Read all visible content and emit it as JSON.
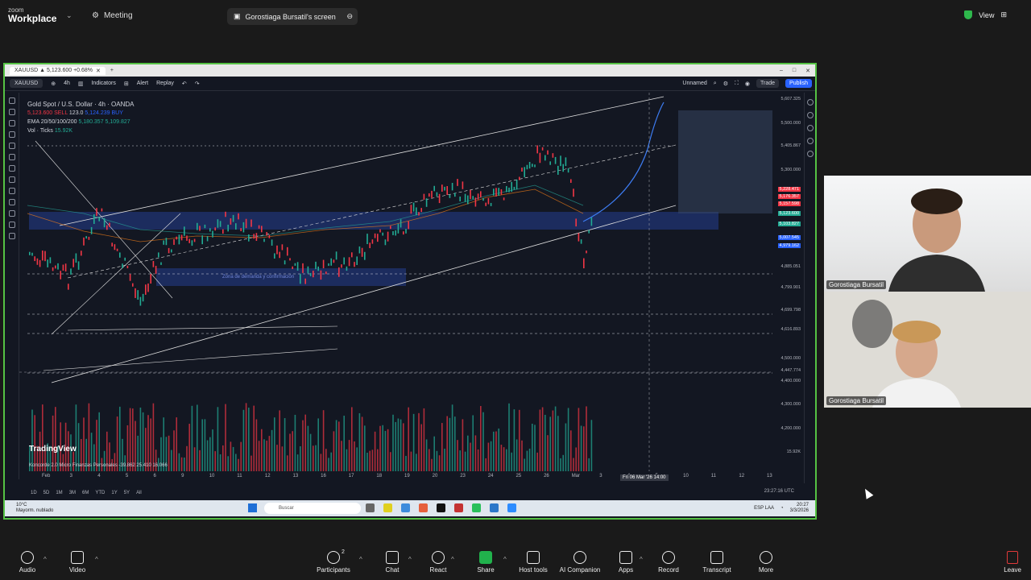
{
  "app": {
    "brand_top": "zoom",
    "brand_bottom": "Workplace",
    "meeting_label": "Meeting",
    "screen_label": "Gorostiaga Bursatil's screen",
    "view_label": "View"
  },
  "browser": {
    "tab_title": "XAUUSD ▲ 5,123.600 +0.68%",
    "plus": "+"
  },
  "tv": {
    "symbol": "XAUUSD",
    "interval": "4h",
    "indicators": "Indicators",
    "alert": "Alert",
    "replay": "Replay",
    "layout_name": "Unnamed",
    "trade": "Trade",
    "publish": "Publish",
    "title": "Gold Spot / U.S. Dollar · 4h · OANDA",
    "sell": "5,123.600 SELL",
    "spread": "123.0",
    "buy": "5,124.239 BUY",
    "ema": "EMA 20/50/100/200",
    "ema_vals": "5,180.357  5,109.827",
    "vol": "Vol · Ticks",
    "vol_val": "15.92K",
    "zone_label": "Zona de demanda y confirmación",
    "tv_logo": "TradingView",
    "concord": "Koncorde 2.0 Micro Finanzas Personales",
    "concord_vals": "-39.862  25.410  16.066",
    "crosshair_date": "Fri 06 Mar '26  14:00",
    "utc": "23:27:16 UTC",
    "ranges": [
      "1D",
      "5D",
      "1M",
      "3M",
      "6M",
      "YTD",
      "1Y",
      "5Y",
      "All"
    ],
    "price_ticks": [
      "5,607.325",
      "5,500.000",
      "5,405.867",
      "5,300.000",
      "5,228.471",
      "5,176.357",
      "5,157.598",
      "5,123.600",
      "5,103.827",
      "5,007.545",
      "4,979.162",
      "4,885.051",
      "4,799.901",
      "4,699.798",
      "4,616.893",
      "4,500.000",
      "4,447.774",
      "4,400.000",
      "4,300.000",
      "4,200.000",
      "15.92K"
    ],
    "dates": [
      "Feb",
      "3",
      "4",
      "5",
      "6",
      "9",
      "10",
      "11",
      "12",
      "13",
      "16",
      "17",
      "18",
      "19",
      "20",
      "23",
      "24",
      "25",
      "26",
      "Mar",
      "3",
      "4",
      "5",
      "10",
      "11",
      "12",
      "13"
    ]
  },
  "taskbar": {
    "weather_temp": "10°C",
    "weather_text": "Mayorm. nublado",
    "search": "Buscar",
    "lang": "ESP LAA",
    "time": "20:27",
    "date": "3/3/2026"
  },
  "participants": [
    {
      "name": "Gorostiaga Bursatil"
    },
    {
      "name": "Gorostiaga Bursatil"
    }
  ],
  "toolbar": {
    "audio": "Audio",
    "video": "Video",
    "participants": "Participants",
    "participants_count": "2",
    "chat": "Chat",
    "react": "React",
    "share": "Share",
    "host_tools": "Host tools",
    "ai_companion": "AI Companion",
    "apps": "Apps",
    "record": "Record",
    "transcript": "Transcript",
    "more": "More",
    "leave": "Leave"
  },
  "colors": {
    "accent_green": "#55c244",
    "bull": "#22ab94",
    "bear": "#f23645",
    "tv_bg": "#131722"
  }
}
